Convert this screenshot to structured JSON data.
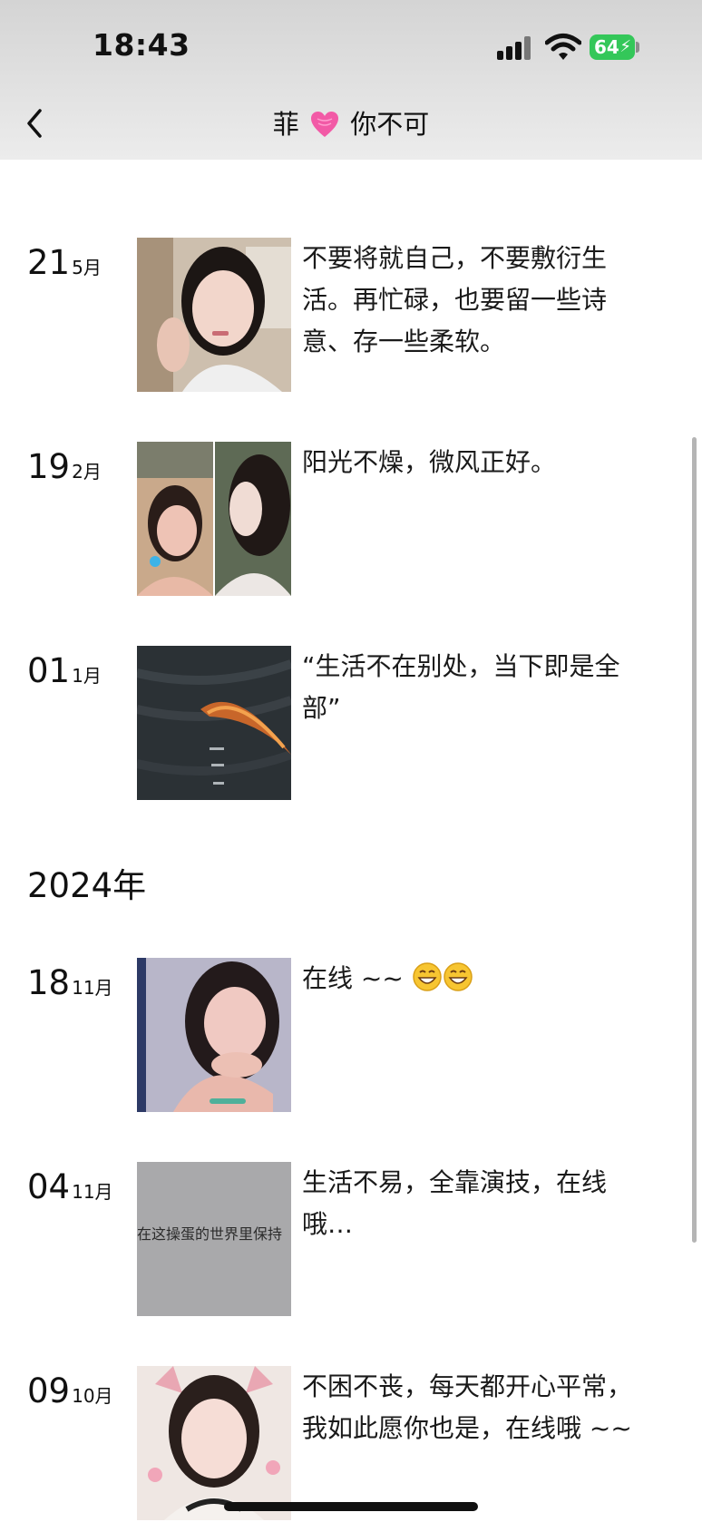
{
  "status_bar": {
    "time": "18:43",
    "battery": "64"
  },
  "nav": {
    "title_left": "菲",
    "title_right": "你不可"
  },
  "posts_2025": [
    {
      "day": "21",
      "month": "5月",
      "text": "不要将就自己，不要敷衍生活。再忙碌，也要留一些诗意、存一些柔软。"
    },
    {
      "day": "19",
      "month": "2月",
      "text": "阳光不燥，微风正好。"
    },
    {
      "day": "01",
      "month": "1月",
      "text": "“生活不在别处，当下即是全部”"
    }
  ],
  "year_label": "2024年",
  "posts_2024": [
    {
      "day": "18",
      "month": "11月",
      "text": "在线 ~~"
    },
    {
      "day": "04",
      "month": "11月",
      "text": "生活不易，全靠演技，在线哦…",
      "image_text": "在这操蛋的世界里保持"
    },
    {
      "day": "09",
      "month": "10月",
      "text": "不困不丧，每天都开心平常，我如此愿你也是，在线哦 ~~"
    }
  ],
  "colors": {
    "battery": "#34c759",
    "header_bg": "#e0e0e0"
  },
  "icons": [
    "back-chevron-icon",
    "heart-icon",
    "signal-icon",
    "wifi-icon",
    "battery-icon",
    "grinning-emoji-icon"
  ]
}
